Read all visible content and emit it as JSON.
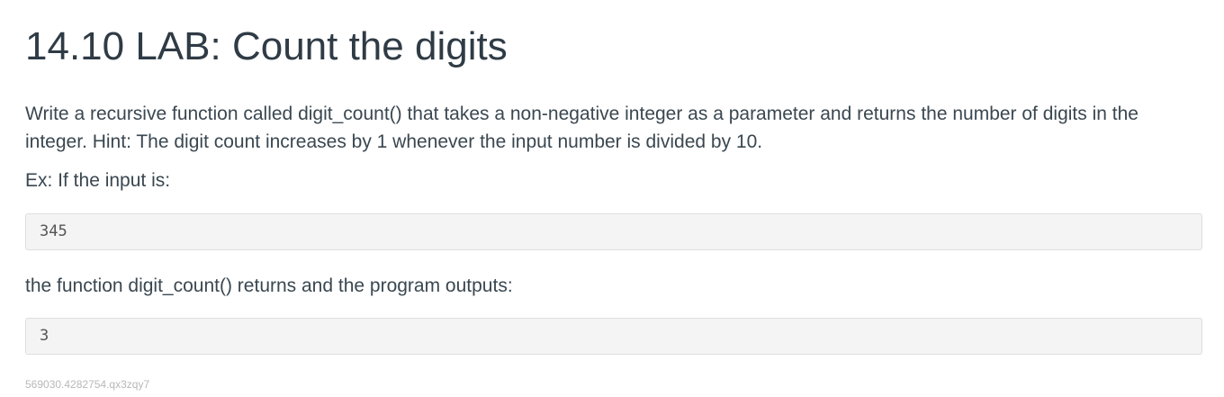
{
  "lab": {
    "title": "14.10 LAB: Count the digits",
    "description": "Write a recursive function called digit_count() that takes a non-negative integer as a parameter and returns the number of digits in the integer. Hint: The digit count increases by 1 whenever the input number is divided by 10.",
    "example_intro": "Ex: If the input is:",
    "example_input": "345",
    "output_intro": "the function digit_count() returns and the program outputs:",
    "example_output": "3",
    "footer_id": "569030.4282754.qx3zqy7"
  }
}
